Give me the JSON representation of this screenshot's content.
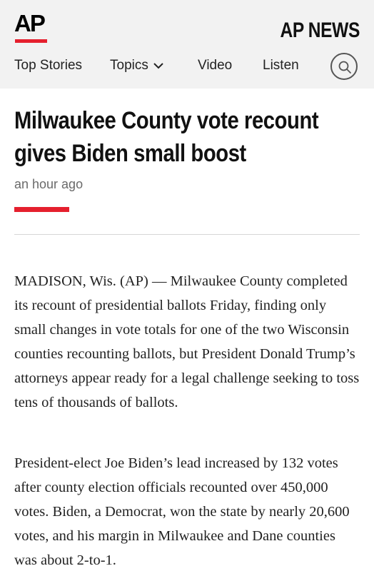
{
  "header": {
    "logo_text": "AP",
    "brand": "AP NEWS",
    "nav": {
      "top_stories": "Top Stories",
      "topics": "Topics",
      "video": "Video",
      "listen": "Listen"
    }
  },
  "article": {
    "headline": "Milwaukee County vote recount gives Biden small boost",
    "timestamp": "an hour ago",
    "paragraphs": [
      "MADISON, Wis. (AP) — Milwaukee County completed its recount of presidential ballots Friday, finding only small changes in vote totals for one of the two Wisconsin counties recounting ballots, but President Donald Trump’s attorneys appear ready for a legal challenge seeking to toss tens of thousands of ballots.",
      "President-elect Joe Biden’s lead increased by 132 votes after county election officials recounted over 450,000 votes. Biden, a Democrat, won the state by nearly 20,600 votes, and his margin in Milwaukee and Dane counties was about 2-to-1."
    ]
  },
  "colors": {
    "accent_red": "#e5202e",
    "header_bg": "#f2f2f2"
  }
}
